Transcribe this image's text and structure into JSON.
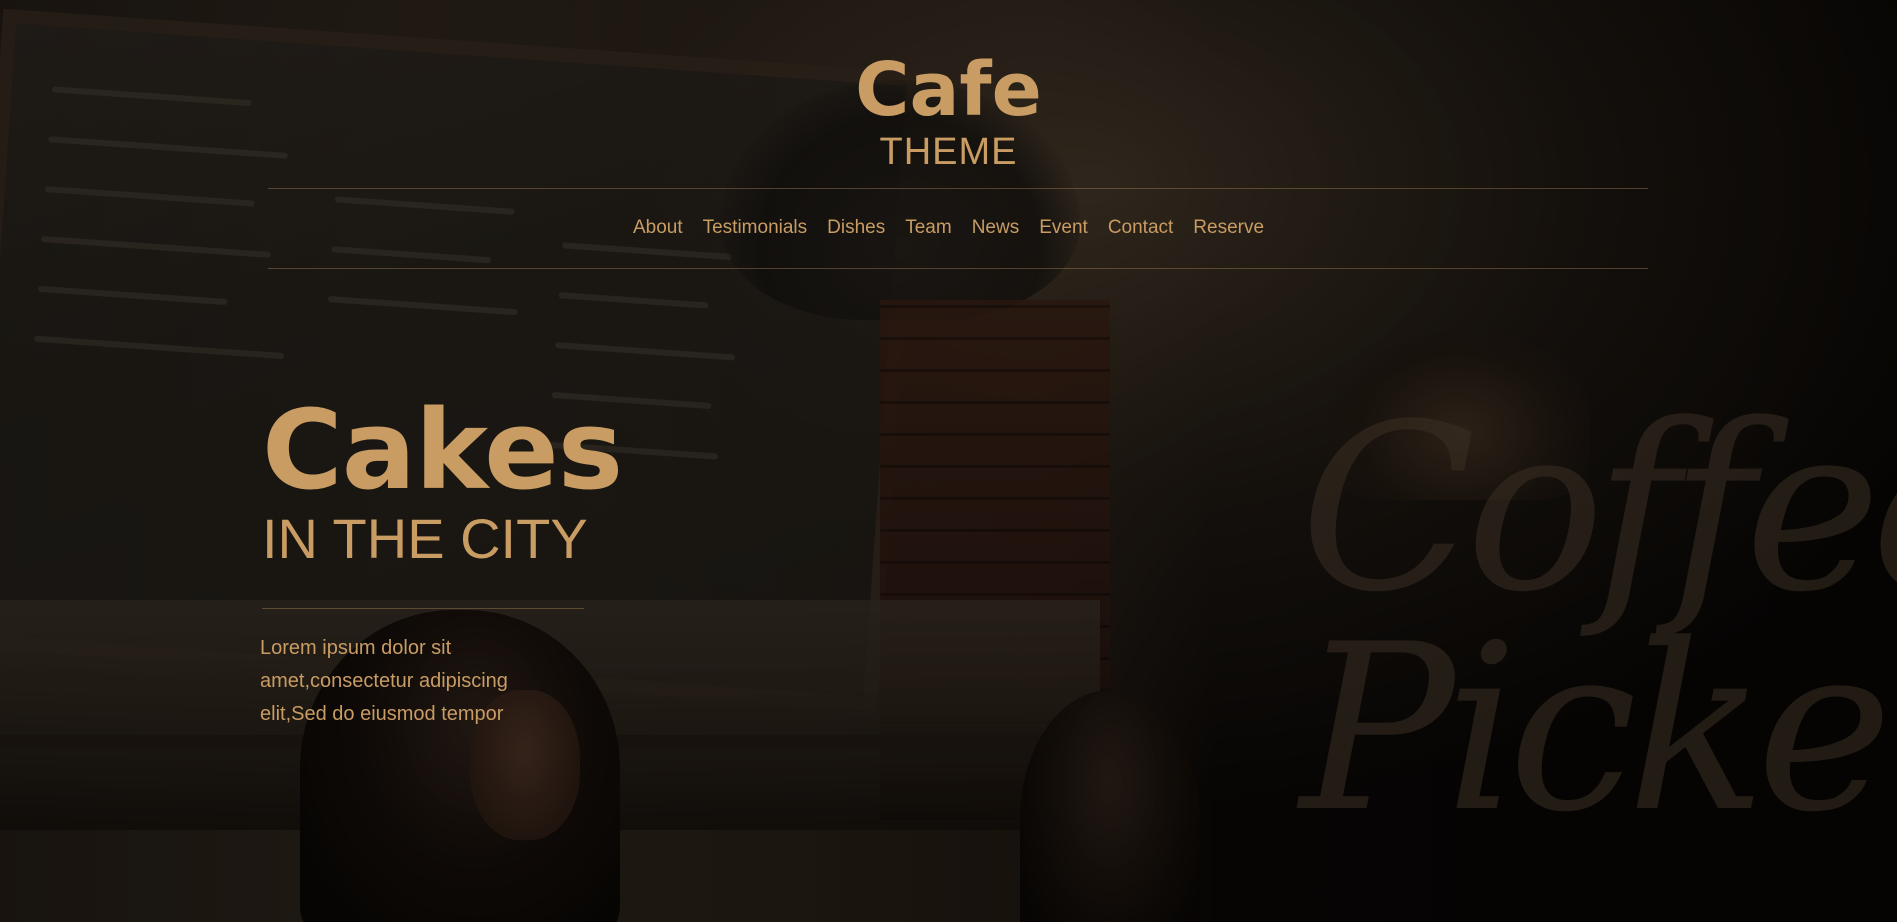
{
  "brand": {
    "title": "Cafe",
    "subtitle": "THEME"
  },
  "nav": {
    "items": [
      {
        "label": "About"
      },
      {
        "label": "Testimonials"
      },
      {
        "label": "Dishes"
      },
      {
        "label": "Team"
      },
      {
        "label": "News"
      },
      {
        "label": "Event"
      },
      {
        "label": "Contact"
      },
      {
        "label": "Reserve"
      }
    ]
  },
  "hero": {
    "title": "Cakes",
    "subtitle": "IN THE CITY",
    "description": "Lorem ipsum dolor sit amet,consectetur adipiscing elit,Sed do eiusmod tempor",
    "background_image": "cafe-interior-photo",
    "background_sign_text": "Coffee Picker"
  },
  "colors": {
    "accent": "#c89c63",
    "overlay": "rgba(0,0,0,0.45)",
    "background": "#0d0a08"
  }
}
